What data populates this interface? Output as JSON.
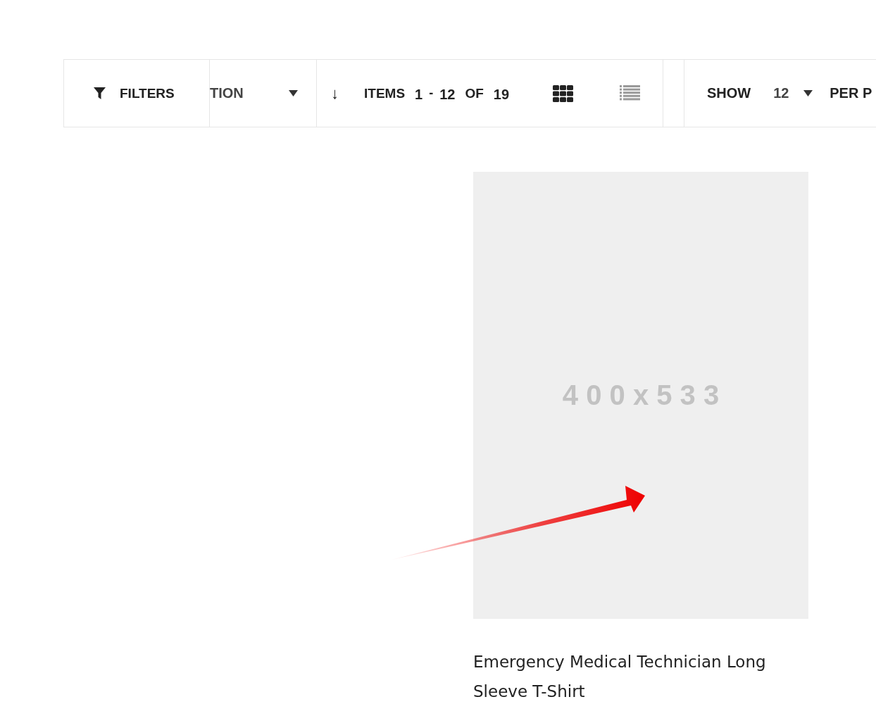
{
  "toolbar": {
    "filters": {
      "label": "FILTERS"
    },
    "sorter": {
      "value": "TION"
    },
    "direction": {
      "symbol": "↓"
    },
    "amount": {
      "label": "ITEMS",
      "from": "1",
      "dash": "-",
      "to": "12",
      "of": "OF",
      "total": "19"
    },
    "view_modes": [
      {
        "kind": "grid",
        "selected": true
      },
      {
        "kind": "list",
        "selected": false
      }
    ],
    "limiter": {
      "label": "SHOW",
      "value": "12",
      "suffix": "PER P"
    }
  },
  "product": {
    "image_text": "4 0 0 x 5 3 3",
    "name": "Emergency Medical Technician Long Sleeve T-Shirt"
  }
}
